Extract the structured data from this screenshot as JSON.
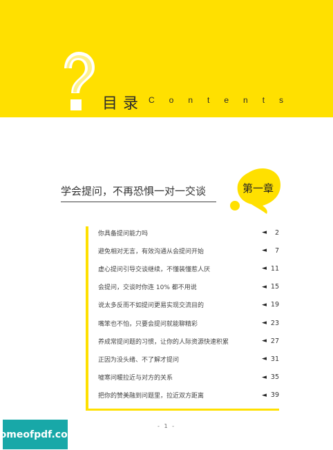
{
  "header": {
    "title_cn": "目录",
    "title_en": "Contents",
    "accent_color": "#ffe000",
    "icon": "question-mark-icon"
  },
  "chapter": {
    "heading": "学会提问，不再恐惧一对一交谈",
    "badge": "第一章"
  },
  "toc": [
    {
      "title": "你具备提问能力吗",
      "page": "2"
    },
    {
      "title": "避免相对无言，有效沟通从会提问开始",
      "page": "7"
    },
    {
      "title": "虚心提问引导交谈继续，不懂装懂惹人厌",
      "page": "11"
    },
    {
      "title": "会提问，交谈时你连 10% 都不用说",
      "page": "15"
    },
    {
      "title": "说太多反而不如提问更易实现交流目的",
      "page": "19"
    },
    {
      "title": "嘴笨也不怕，只要会提问就能聊精彩",
      "page": "23"
    },
    {
      "title": "养成常提问题的习惯，让你的人际资源快速积累",
      "page": "27"
    },
    {
      "title": "正因为没头绪、不了解才提问",
      "page": "31"
    },
    {
      "title": "嘘寒问暖拉近与对方的关系",
      "page": "35"
    },
    {
      "title": "把你的赞美融到问题里，拉近双方距离",
      "page": "39"
    }
  ],
  "footer": {
    "page_number": "- 1 -",
    "watermark": "homeofpdf.com"
  }
}
